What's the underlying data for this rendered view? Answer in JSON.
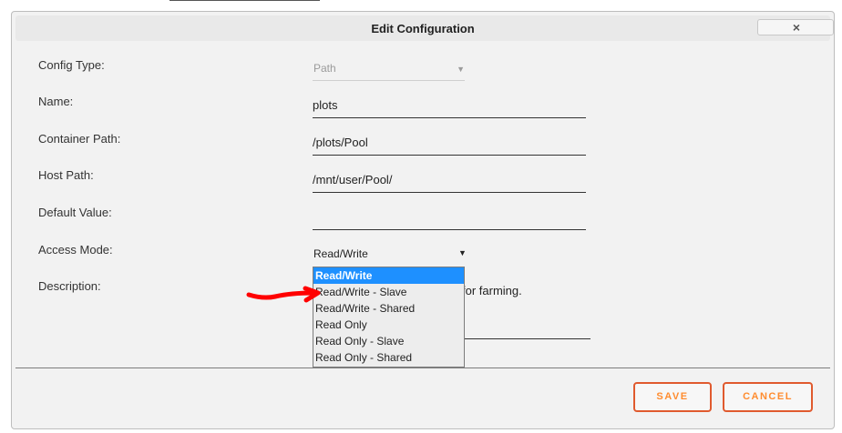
{
  "dialog": {
    "title": "Edit Configuration",
    "close_icon": "close-icon"
  },
  "form": {
    "config_type": {
      "label": "Config Type:",
      "value": "Path"
    },
    "name": {
      "label": "Name:",
      "value": "plots"
    },
    "container_path": {
      "label": "Container Path:",
      "value": "/plots/Pool"
    },
    "host_path": {
      "label": "Host Path:",
      "value": "/mnt/user/Pool/"
    },
    "default_value": {
      "label": "Default Value:",
      "value": ""
    },
    "access_mode": {
      "label": "Access Mode:",
      "value": "Read/Write",
      "options": [
        "Read/Write",
        "Read/Write - Slave",
        "Read/Write - Shared",
        "Read Only",
        "Read Only - Slave",
        "Read Only - Shared"
      ]
    },
    "description": {
      "label": "Description:",
      "visible_text": "for farming."
    }
  },
  "buttons": {
    "save": "SAVE",
    "cancel": "CANCEL"
  },
  "colors": {
    "accent": "#ff8c2f",
    "button_border": "#e05a2e",
    "selection": "#1e90ff",
    "annotation": "#ff0000"
  }
}
